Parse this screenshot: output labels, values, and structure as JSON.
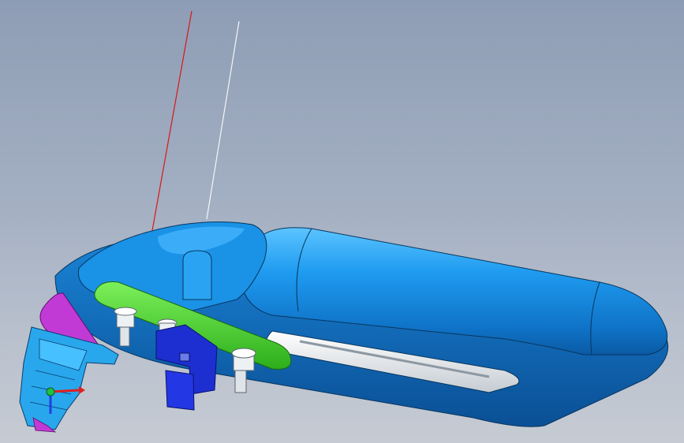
{
  "viewport": {
    "background_top": "#8e9db5",
    "background_bottom": "#c6cbd3"
  },
  "model": {
    "body_color": "#1a8fe0",
    "body_highlight": "#43b6ff",
    "body_shadow": "#0b5da8",
    "flange_color": "#4fd52c",
    "bracket_color": "#1d2fd0",
    "clip_color": "#c23ad6",
    "connector_color": "#29a7ec",
    "slot_color": "#e8ecef",
    "boss_color": "#eef1f4"
  },
  "axis_lines": {
    "line_a_color": "#d81818",
    "line_b_color": "#f4f6f8"
  },
  "triad": {
    "x_color": "#e02020",
    "y_color": "#20c040",
    "z_color": "#2040e0"
  }
}
